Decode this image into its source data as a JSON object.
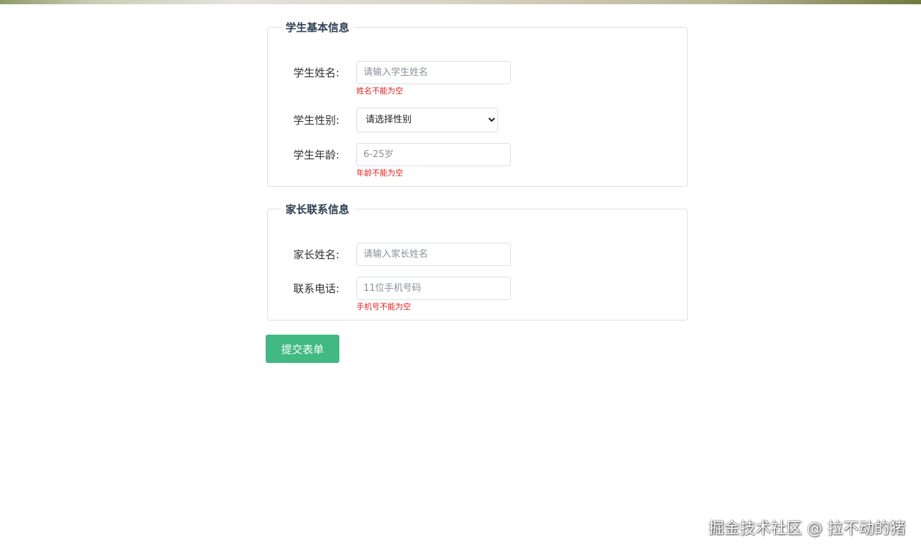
{
  "student_section": {
    "title": "学生基本信息",
    "name_label": "学生姓名:",
    "name_placeholder": "请输入学生姓名",
    "name_error": "姓名不能为空",
    "gender_label": "学生性别:",
    "gender_selected": "请选择性别",
    "age_label": "学生年龄:",
    "age_placeholder": "6-25岁",
    "age_error": "年龄不能为空"
  },
  "parent_section": {
    "title": "家长联系信息",
    "name_label": "家长姓名:",
    "name_placeholder": "请输入家长姓名",
    "phone_label": "联系电话:",
    "phone_placeholder": "11位手机号码",
    "phone_error": "手机号不能为空"
  },
  "submit_label": "提交表单",
  "watermark": "掘金技术社区 @ 拉不动的猪",
  "colors": {
    "accent": "#42b983",
    "error": "#e02020",
    "border": "#dcdfe6"
  }
}
